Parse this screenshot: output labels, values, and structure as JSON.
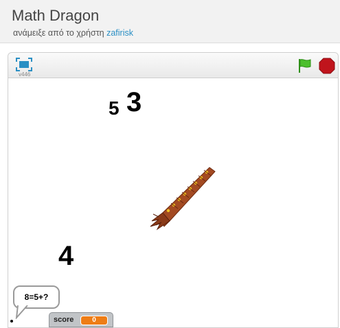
{
  "project": {
    "title": "Math Dragon",
    "byline_prefix": "ανάμειξε από το χρήστη",
    "author": "zafirisk"
  },
  "player": {
    "version": "v446",
    "icons": [
      "fullscreen-icon",
      "green-flag-icon",
      "stop-icon"
    ],
    "colors": {
      "flag": "#4cbf2c",
      "stop": "#c0141c",
      "accent": "#2a8fc4"
    }
  },
  "stage": {
    "numbers": [
      "5",
      "3",
      "4"
    ],
    "speech_bubble": "8=5+?",
    "score_monitor": {
      "label": "score",
      "value": "0"
    }
  }
}
